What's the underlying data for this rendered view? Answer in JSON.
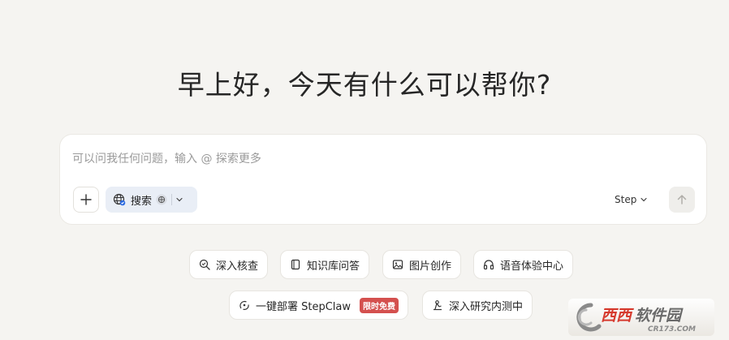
{
  "greeting": "早上好，今天有什么可以帮你?",
  "composer": {
    "placeholder": "可以问我任何问题，输入 @ 探索更多",
    "value": "",
    "search_label": "搜索",
    "model_label": "Step"
  },
  "quick_actions": {
    "row1": [
      {
        "label": "深入核查",
        "icon": "magnify-check-icon"
      },
      {
        "label": "知识库问答",
        "icon": "book-icon"
      },
      {
        "label": "图片创作",
        "icon": "image-icon"
      },
      {
        "label": "语音体验中心",
        "icon": "headphones-icon"
      }
    ],
    "row2": [
      {
        "label": "一键部署 StepClaw",
        "icon": "claw-icon",
        "badge": "限时免费"
      },
      {
        "label": "深入研究内测中",
        "icon": "research-icon"
      }
    ]
  },
  "watermark": {
    "brand": "西西软件园",
    "domain": "CR173.COM"
  },
  "colors": {
    "background": "#f5f4f1",
    "search_chip": "#e9eef6",
    "badge": "#d4504e",
    "watermark_red": "#d63a2e"
  }
}
